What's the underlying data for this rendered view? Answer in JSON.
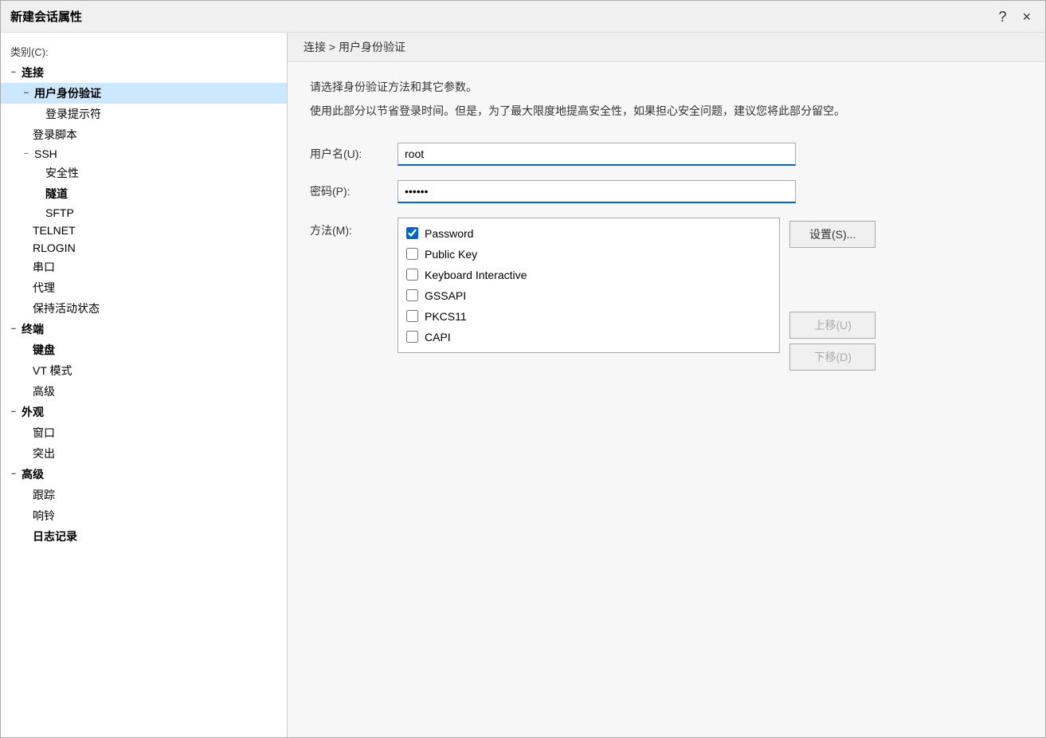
{
  "dialog": {
    "title": "新建会话属性",
    "help_button": "?",
    "close_button": "×"
  },
  "category": {
    "label": "类别(C):"
  },
  "tree": {
    "items": [
      {
        "id": "connect",
        "label": "连接",
        "indent": 1,
        "bold": true,
        "icon": "−"
      },
      {
        "id": "auth",
        "label": "用户身份验证",
        "indent": 2,
        "bold": true,
        "icon": "−",
        "selected": true
      },
      {
        "id": "login-prompt",
        "label": "登录提示符",
        "indent": 3,
        "bold": false,
        "icon": ""
      },
      {
        "id": "login-script",
        "label": "登录脚本",
        "indent": 2,
        "bold": false,
        "icon": ""
      },
      {
        "id": "ssh",
        "label": "SSH",
        "indent": 2,
        "bold": false,
        "icon": "−"
      },
      {
        "id": "security",
        "label": "安全性",
        "indent": 3,
        "bold": false,
        "icon": ""
      },
      {
        "id": "tunnel",
        "label": "隧道",
        "indent": 3,
        "bold": true,
        "icon": ""
      },
      {
        "id": "sftp",
        "label": "SFTP",
        "indent": 3,
        "bold": false,
        "icon": ""
      },
      {
        "id": "telnet",
        "label": "TELNET",
        "indent": 2,
        "bold": false,
        "icon": ""
      },
      {
        "id": "rlogin",
        "label": "RLOGIN",
        "indent": 2,
        "bold": false,
        "icon": ""
      },
      {
        "id": "serial",
        "label": "串口",
        "indent": 2,
        "bold": false,
        "icon": ""
      },
      {
        "id": "proxy",
        "label": "代理",
        "indent": 2,
        "bold": false,
        "icon": ""
      },
      {
        "id": "keepalive",
        "label": "保持活动状态",
        "indent": 2,
        "bold": false,
        "icon": ""
      },
      {
        "id": "terminal",
        "label": "终端",
        "indent": 1,
        "bold": true,
        "icon": "−"
      },
      {
        "id": "keyboard",
        "label": "键盘",
        "indent": 2,
        "bold": true,
        "icon": ""
      },
      {
        "id": "vt-mode",
        "label": "VT 模式",
        "indent": 2,
        "bold": false,
        "icon": ""
      },
      {
        "id": "advanced",
        "label": "高级",
        "indent": 2,
        "bold": false,
        "icon": ""
      },
      {
        "id": "appearance",
        "label": "外观",
        "indent": 1,
        "bold": true,
        "icon": "−"
      },
      {
        "id": "window",
        "label": "窗口",
        "indent": 2,
        "bold": false,
        "icon": ""
      },
      {
        "id": "highlight",
        "label": "突出",
        "indent": 2,
        "bold": false,
        "icon": ""
      },
      {
        "id": "advanced-top",
        "label": "高级",
        "indent": 1,
        "bold": true,
        "icon": "−"
      },
      {
        "id": "trace",
        "label": "跟踪",
        "indent": 2,
        "bold": false,
        "icon": ""
      },
      {
        "id": "bell",
        "label": "响铃",
        "indent": 2,
        "bold": false,
        "icon": ""
      },
      {
        "id": "log",
        "label": "日志记录",
        "indent": 2,
        "bold": true,
        "icon": ""
      }
    ]
  },
  "right_panel": {
    "breadcrumb": "连接 > 用户身份验证",
    "desc1": "请选择身份验证方法和其它参数。",
    "desc2": "使用此部分以节省登录时间。但是，为了最大限度地提高安全性，如果担心安全问题，建议您将此部分留空。",
    "username_label": "用户名(U):",
    "username_value": "root",
    "password_label": "密码(P):",
    "password_value": "••••••",
    "method_label": "方法(M):",
    "methods": [
      {
        "id": "password",
        "label": "Password",
        "checked": true
      },
      {
        "id": "public-key",
        "label": "Public Key",
        "checked": false
      },
      {
        "id": "keyboard-interactive",
        "label": "Keyboard Interactive",
        "checked": false
      },
      {
        "id": "gssapi",
        "label": "GSSAPI",
        "checked": false
      },
      {
        "id": "pkcs11",
        "label": "PKCS11",
        "checked": false
      },
      {
        "id": "capi",
        "label": "CAPI",
        "checked": false
      }
    ],
    "settings_button": "设置(S)...",
    "move_up_button": "上移(U)",
    "move_down_button": "下移(D)"
  }
}
